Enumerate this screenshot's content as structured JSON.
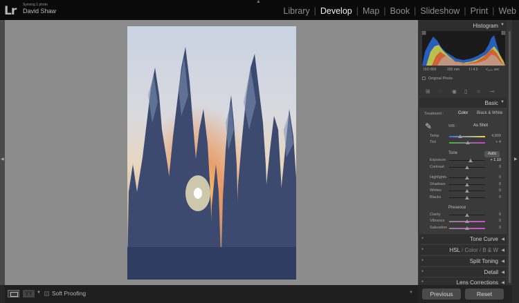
{
  "app": {
    "logo": "Lr",
    "sync_status": "Syncing 1 photo",
    "user": "David Shaw"
  },
  "modules": [
    {
      "label": "Library",
      "active": false
    },
    {
      "label": "Develop",
      "active": true
    },
    {
      "label": "Map",
      "active": false
    },
    {
      "label": "Book",
      "active": false
    },
    {
      "label": "Slideshow",
      "active": false
    },
    {
      "label": "Print",
      "active": false
    },
    {
      "label": "Web",
      "active": false
    }
  ],
  "toolbar": {
    "soft_proofing": "Soft Proofing",
    "compare": "YY"
  },
  "panels": {
    "histogram": {
      "title": "Histogram",
      "iso": "ISO 800",
      "focal": "200 mm",
      "aperture": "f / 4.0",
      "shutter": "¹⁄₁₆₀₀ sec",
      "original_photo": "Original Photo"
    },
    "basic": {
      "title": "Basic",
      "treatment_label": "Treatment :",
      "treatment_color": "Color",
      "treatment_bw": "Black & White",
      "wb_label": "WB :",
      "wb_value": "As Shot",
      "temp": {
        "label": "Temp",
        "value": "4,800",
        "pos": 0.3
      },
      "tint": {
        "label": "Tint",
        "value": "+ 4",
        "pos": 0.52
      },
      "tone_label": "Tone",
      "auto": "Auto",
      "exposure": {
        "label": "Exposure",
        "value": "+ 1.10",
        "pos": 0.6
      },
      "contrast": {
        "label": "Contrast",
        "value": "0",
        "pos": 0.5
      },
      "highlights": {
        "label": "Highlights",
        "value": "0",
        "pos": 0.5
      },
      "shadows": {
        "label": "Shadows",
        "value": "0",
        "pos": 0.5
      },
      "whites": {
        "label": "Whites",
        "value": "0",
        "pos": 0.5
      },
      "blacks": {
        "label": "Blacks",
        "value": "0",
        "pos": 0.5
      },
      "presence_label": "Presence",
      "clarity": {
        "label": "Clarity",
        "value": "0",
        "pos": 0.5
      },
      "vibrance": {
        "label": "Vibrance",
        "value": "0",
        "pos": 0.5
      },
      "saturation": {
        "label": "Saturation",
        "value": "0",
        "pos": 0.5
      }
    },
    "tone_curve": "Tone Curve",
    "hsl": "HSL",
    "hsl_sep1": "/",
    "hsl_color": "Color",
    "hsl_sep2": "/",
    "hsl_bw": "B & W",
    "split_toning": "Split Toning",
    "detail": "Detail",
    "lens_corrections": "Lens Corrections"
  },
  "buttons": {
    "previous": "Previous",
    "reset": "Reset"
  }
}
